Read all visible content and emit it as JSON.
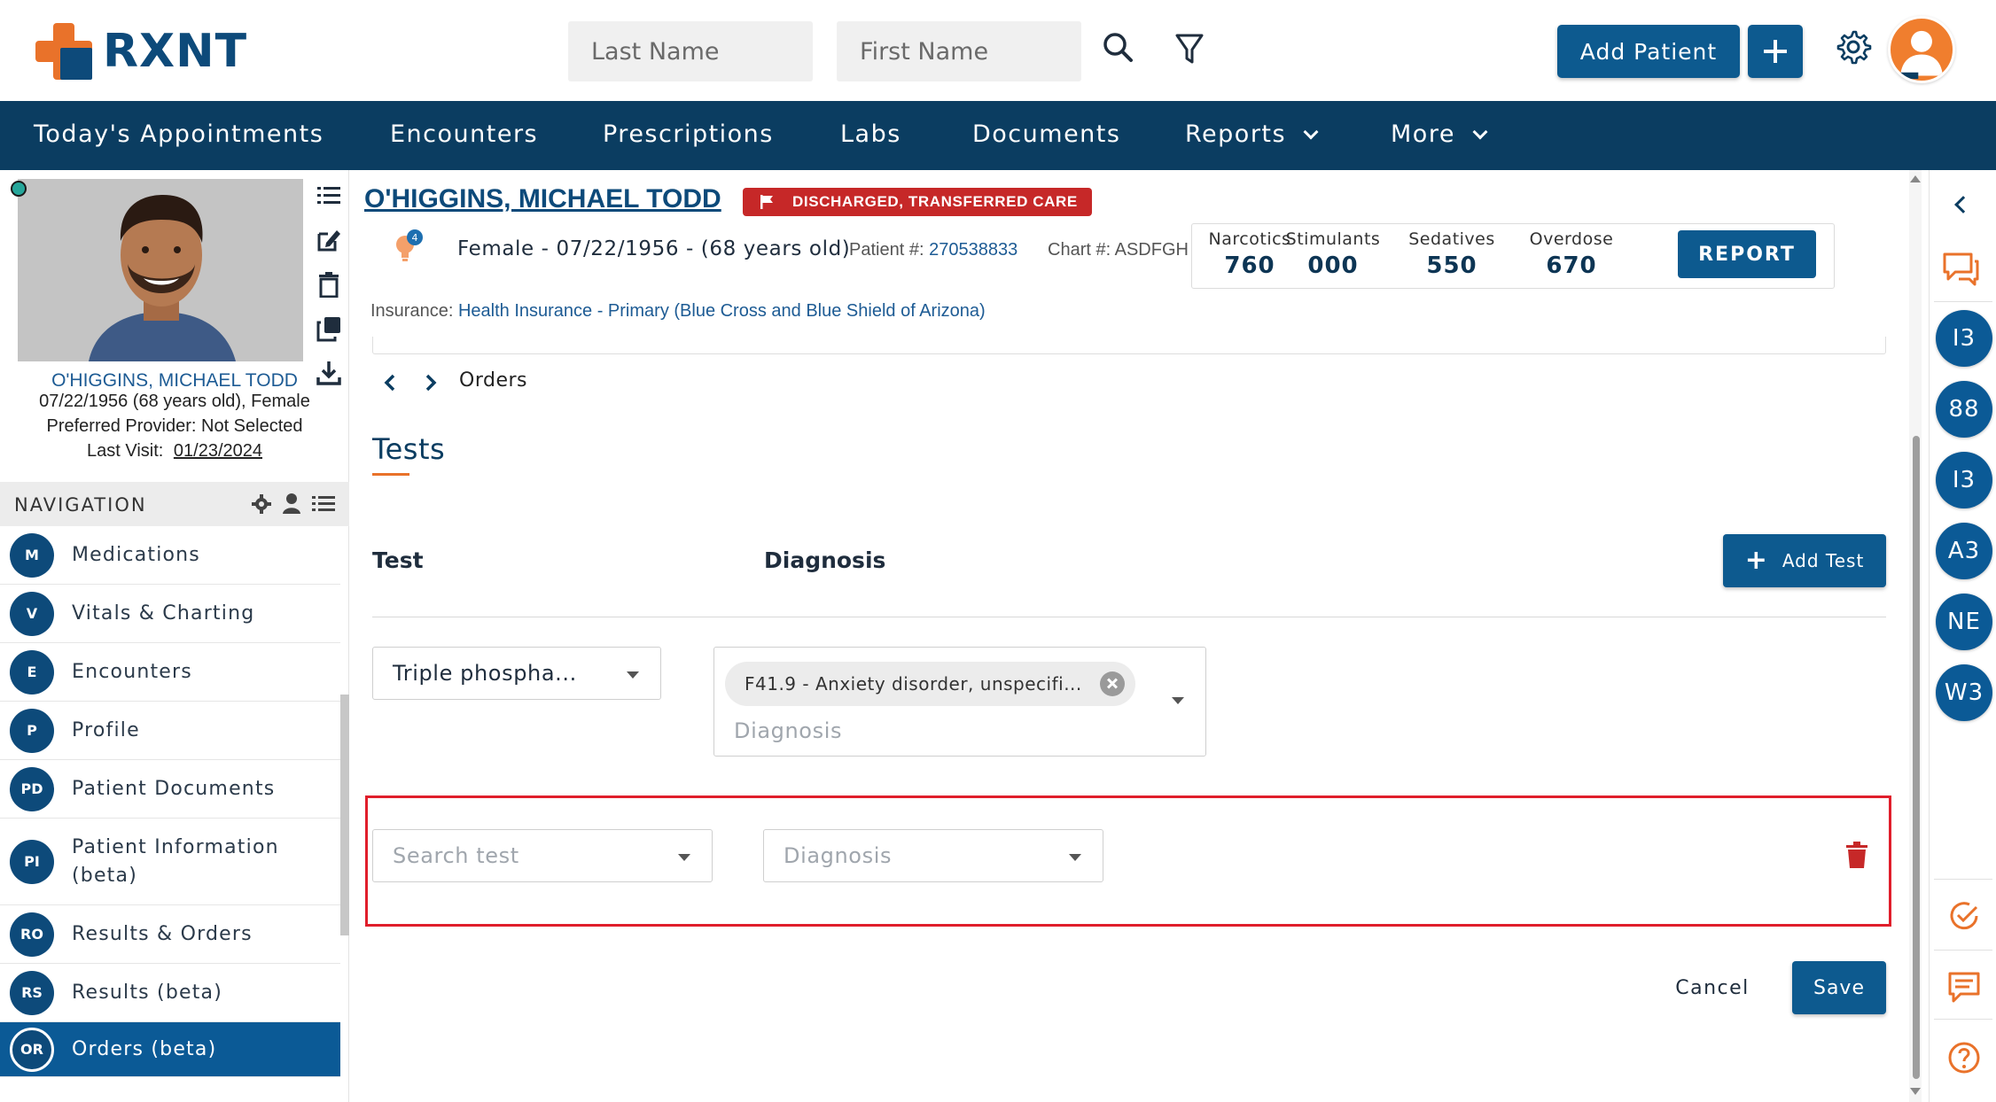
{
  "brand": {
    "name": "RXNT"
  },
  "search": {
    "last_name_placeholder": "Last Name",
    "first_name_placeholder": "First Name"
  },
  "header_actions": {
    "add_patient_label": "Add Patient"
  },
  "main_nav": [
    {
      "label": "Today's Appointments",
      "dropdown": false
    },
    {
      "label": "Encounters",
      "dropdown": false
    },
    {
      "label": "Prescriptions",
      "dropdown": false
    },
    {
      "label": "Labs",
      "dropdown": false
    },
    {
      "label": "Documents",
      "dropdown": false
    },
    {
      "label": "Reports",
      "dropdown": true
    },
    {
      "label": "More",
      "dropdown": true
    }
  ],
  "patient": {
    "name": "O'HIGGINS, MICHAEL TODD",
    "status": "DISCHARGED, TRANSFERRED CARE",
    "alert_count": "4",
    "demographics": "Female - 07/22/1956 - (68 years old)",
    "patient_number_label": "Patient #:",
    "patient_number": "270538833",
    "chart_number_label": "Chart #:",
    "chart_number": "ASDFGH",
    "insurance_label": "Insurance:",
    "insurance": "Health Insurance - Primary (Blue Cross and Blue Shield of Arizona)"
  },
  "left_panel": {
    "name": "O'HIGGINS, MICHAEL TODD",
    "dob_line": "07/22/1956 (68 years old), Female",
    "provider_line": "Preferred Provider: Not Selected",
    "last_visit_label": "Last Visit:",
    "last_visit": "01/23/2024",
    "nav_title": "NAVIGATION",
    "nav_items": [
      {
        "badge": "M",
        "label": "Medications"
      },
      {
        "badge": "V",
        "label": "Vitals & Charting"
      },
      {
        "badge": "E",
        "label": "Encounters"
      },
      {
        "badge": "P",
        "label": "Profile"
      },
      {
        "badge": "PD",
        "label": "Patient Documents"
      },
      {
        "badge": "PI",
        "label": "Patient Information\n(beta)"
      },
      {
        "badge": "RO",
        "label": "Results & Orders"
      },
      {
        "badge": "RS",
        "label": "Results (beta)"
      },
      {
        "badge": "OR",
        "label": "Orders (beta)",
        "active": true
      }
    ]
  },
  "pdmp": {
    "items": [
      {
        "label": "Narcotics",
        "value": "760"
      },
      {
        "label": "Stimulants",
        "value": "000"
      },
      {
        "label": "Sedatives",
        "value": "550"
      },
      {
        "label": "Overdose",
        "value": "670"
      }
    ],
    "report_label": "REPORT"
  },
  "breadcrumb": {
    "label": "Orders"
  },
  "tests": {
    "title": "Tests",
    "col_test": "Test",
    "col_diagnosis": "Diagnosis",
    "add_test_label": "Add Test",
    "row1": {
      "test_value": "Triple phospha...",
      "diagnosis_chip": "F41.9 - Anxiety disorder, unspecifi...",
      "diagnosis_placeholder": "Diagnosis"
    },
    "row2": {
      "test_placeholder": "Search test",
      "diagnosis_placeholder": "Diagnosis"
    }
  },
  "footer": {
    "cancel_label": "Cancel",
    "save_label": "Save"
  },
  "right_rail": {
    "circles": [
      "I3",
      "88",
      "I3",
      "A3",
      "NE",
      "W3"
    ]
  },
  "colors": {
    "primary": "#0d5a8f",
    "nav_bg": "#0b3d61",
    "accent": "#e9722a",
    "danger": "#c62828",
    "highlight_box": "#e01e2b"
  }
}
